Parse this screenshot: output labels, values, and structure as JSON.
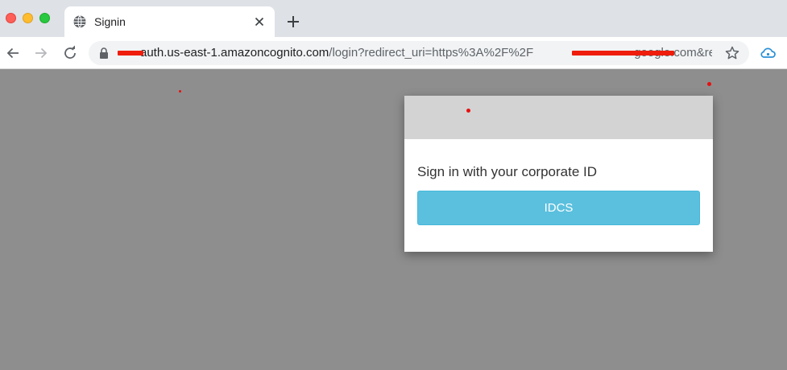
{
  "browser": {
    "tab": {
      "title": "Signin",
      "favicon": "globe-icon"
    },
    "address_bar": {
      "url_host": "auth.us-east-1.amazoncognito.com",
      "url_path": "/login?redirect_uri=https%3A%2F%2F",
      "url_tail": "google.com&res…"
    },
    "icons": {
      "back": "arrow-left-icon",
      "forward": "arrow-right-icon",
      "reload": "reload-icon",
      "lock": "lock-icon",
      "bookmark": "star-icon",
      "extension": "cloud-icon",
      "new_tab": "plus-icon",
      "close_tab": "close-icon"
    }
  },
  "signin": {
    "label": "Sign in with your corporate ID",
    "provider_button": "IDCS"
  },
  "colors": {
    "page_background": "#8e8e8e",
    "modal_header": "#d3d3d3",
    "button": "#5bc0de",
    "redaction": "#ee1d0c"
  }
}
